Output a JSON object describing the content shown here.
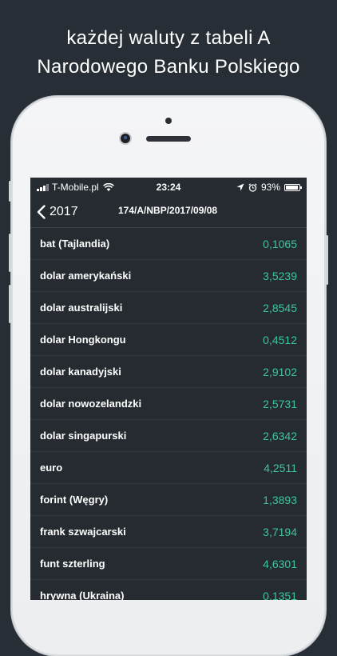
{
  "headline": {
    "line1": "każdej waluty z tabeli A",
    "line2": "Narodowego Banku Polskiego"
  },
  "status_bar": {
    "carrier": "T-Mobile.pl",
    "time": "23:24",
    "battery": "93%",
    "icons": [
      "signal-icon",
      "wifi-icon",
      "location-icon",
      "alarm-icon",
      "battery-icon"
    ]
  },
  "nav": {
    "back_label": "2017",
    "title": "174/A/NBP/2017/09/08"
  },
  "colors": {
    "background": "#272e35",
    "screen": "#252b31",
    "rate": "#3cc59a"
  },
  "currencies": [
    {
      "name": "bat (Tajlandia)",
      "rate": "0,1065"
    },
    {
      "name": "dolar amerykański",
      "rate": "3,5239"
    },
    {
      "name": "dolar australijski",
      "rate": "2,8545"
    },
    {
      "name": "dolar Hongkongu",
      "rate": "0,4512"
    },
    {
      "name": "dolar kanadyjski",
      "rate": "2,9102"
    },
    {
      "name": "dolar nowozelandzki",
      "rate": "2,5731"
    },
    {
      "name": "dolar singapurski",
      "rate": "2,6342"
    },
    {
      "name": "euro",
      "rate": "4,2511"
    },
    {
      "name": "forint (Węgry)",
      "rate": "1,3893"
    },
    {
      "name": "frank szwajcarski",
      "rate": "3,7194"
    },
    {
      "name": "funt szterling",
      "rate": "4,6301"
    },
    {
      "name": "hrywna (Ukraina)",
      "rate": "0,1351"
    }
  ]
}
